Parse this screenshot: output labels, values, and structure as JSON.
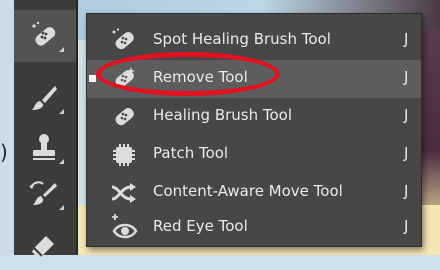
{
  "toolbar": {
    "tools": [
      {
        "icon": "spot-healing-brush-icon",
        "active": true
      },
      {
        "icon": "brush-icon",
        "active": false
      },
      {
        "icon": "clone-stamp-icon",
        "active": false
      },
      {
        "icon": "history-brush-icon",
        "active": false
      },
      {
        "icon": "eraser-icon",
        "active": false
      }
    ]
  },
  "menu": {
    "items": [
      {
        "label": "Spot Healing Brush Tool",
        "shortcut": "J",
        "icon": "spot-healing-brush-icon",
        "selected": false
      },
      {
        "label": "Remove Tool",
        "shortcut": "J",
        "icon": "remove-tool-icon",
        "selected": true
      },
      {
        "label": "Healing Brush Tool",
        "shortcut": "J",
        "icon": "healing-brush-icon",
        "selected": false
      },
      {
        "label": "Patch Tool",
        "shortcut": "J",
        "icon": "patch-icon",
        "selected": false
      },
      {
        "label": "Content-Aware Move Tool",
        "shortcut": "J",
        "icon": "content-aware-move-icon",
        "selected": false
      },
      {
        "label": "Red Eye Tool",
        "shortcut": "J",
        "icon": "red-eye-icon",
        "selected": false
      }
    ]
  },
  "annotation": {
    "color": "#e0121f"
  },
  "colors": {
    "toolbar": "#3c3c3c",
    "menu": "#474747",
    "menu_selected": "#5d5d5d",
    "text": "#eaeaea"
  },
  "edge_glyph": ")"
}
